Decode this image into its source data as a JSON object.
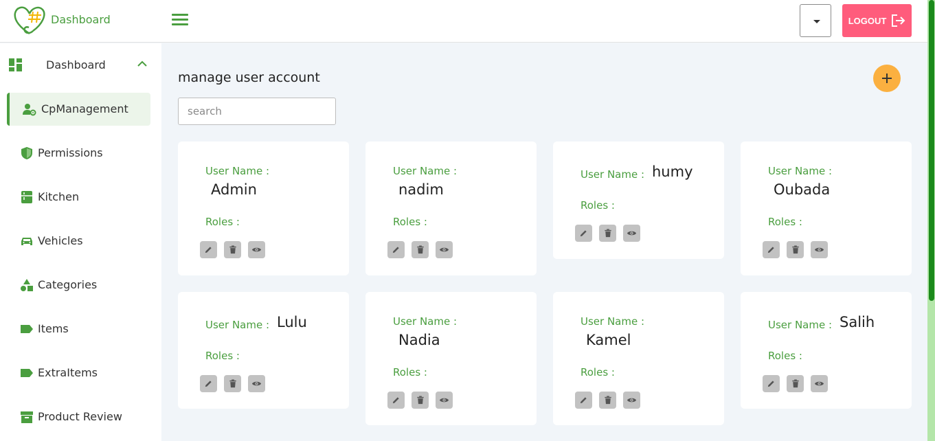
{
  "header": {
    "brand": "Dashboard",
    "logout_label": "LOGOUT"
  },
  "sidebar": {
    "top": {
      "label": "Dashboard",
      "icon": "dashboard-icon"
    },
    "items": [
      {
        "label": "CpManagement",
        "icon": "user-gear-icon",
        "active": true
      },
      {
        "label": "Permissions",
        "icon": "shield-icon"
      },
      {
        "label": "Kitchen",
        "icon": "kitchen-icon"
      },
      {
        "label": "Vehicles",
        "icon": "car-icon"
      },
      {
        "label": "Categories",
        "icon": "shapes-icon"
      },
      {
        "label": "Items",
        "icon": "label-icon"
      },
      {
        "label": "ExtraItems",
        "icon": "label-icon"
      },
      {
        "label": "Product Review",
        "icon": "archive-icon"
      }
    ]
  },
  "main": {
    "title": "manage user account",
    "search_placeholder": "search",
    "user_name_label": "User Name :",
    "roles_label": "Roles :",
    "cards": [
      {
        "name": "Admin"
      },
      {
        "name": "nadim"
      },
      {
        "name": "humy"
      },
      {
        "name": "Oubada"
      },
      {
        "name": "Lulu"
      },
      {
        "name": "Nadia"
      },
      {
        "name": "Kamel"
      },
      {
        "name": "Salih"
      }
    ]
  },
  "colors": {
    "brand_green": "#4a9e3f",
    "logout_pink": "#ff5c7c",
    "add_orange": "#fbb040",
    "scroll_thumb": "#1b8a1b"
  }
}
